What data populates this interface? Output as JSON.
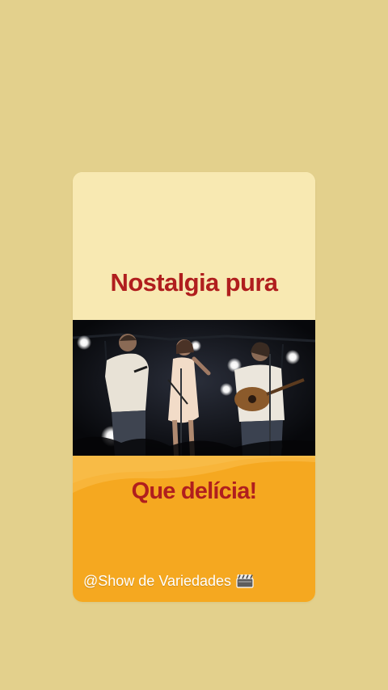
{
  "story": {
    "headline": "Nostalgia pura",
    "subheadline": "Que delícia!",
    "handle": "@Show de Variedades",
    "handle_icon": "clapperboard-icon"
  },
  "colors": {
    "page_background": "#e3d08c",
    "card_top": "#f8e9b2",
    "card_bottom": "#f5a820",
    "headline_text": "#b01e1e",
    "handle_text": "#ffffff"
  }
}
